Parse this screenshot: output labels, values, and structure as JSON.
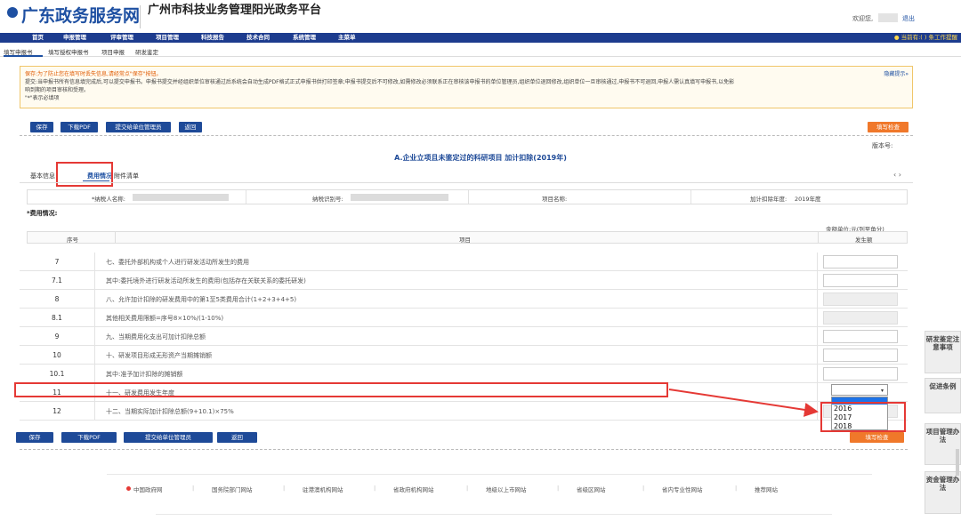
{
  "header": {
    "site_name": "广东政务服务网",
    "platform_title": "广州市科技业务管理阳光政务平台",
    "welcome": "欢迎您,",
    "logout": "退出"
  },
  "nav": {
    "items": [
      "首页",
      "申报管理",
      "评审管理",
      "项目管理",
      "科技报告",
      "技术合同",
      "系统管理",
      "主菜单"
    ],
    "current": "● 当前有:(  ) 条工作提醒"
  },
  "sub_nav": {
    "items": [
      "填写申报书",
      "填写授权申报书",
      "项目申报",
      "研发鉴定"
    ]
  },
  "notice": {
    "line1": "保存:为了防止您在填写时丢失信息,请经常点\"保存\"按钮。",
    "line2": "提交:当申报书所有信息填完成后,可以提交申报书。申报书提交并经组织单位审核通过后系统会自动生成PDF格式正式申报书供打印签章;申报书提交后不可修改,如需修改必须联系正在审核该申报书的单位管理员,组织单位退回修改,组织单位一旦审核通过,申报书不可退回,申报人需认真填写申报书,以免影",
    "line3": "响到期的项目审核和受理。",
    "line4": "\"*\"表示必填项",
    "hint_link": "隐藏提示»"
  },
  "toolbar": {
    "save": "保存",
    "download_pdf": "下载PDF",
    "submit": "提交给单位管理员",
    "back": "返回",
    "check": "填写检查"
  },
  "form": {
    "version_label": "版本号:",
    "title": "A.企业立项且未鉴定过的科研项目 加计扣除(2019年)",
    "tabs": [
      "基本信息",
      "费用情况",
      "附件清单"
    ],
    "tab_arrows": "‹ ›",
    "info": {
      "taxpayer_name_label": "*纳税人名称:",
      "taxpayer_id_label": "纳税识别号:",
      "project_name_label": "项目名称:",
      "deduction_year_label": "加计扣除年度:",
      "deduction_year_value": "2019年度"
    },
    "expense_section": "*费用情况:",
    "unit": "金额单位:元(列至角分)",
    "columns": [
      "序号",
      "项目",
      "发生额"
    ]
  },
  "rows": [
    {
      "no": "7",
      "item": "七、委托外部机构或个人进行研发活动所发生的费用",
      "disabled": false
    },
    {
      "no": "7.1",
      "item": "其中:委托境外进行研发活动所发生的费用(包括存在关联关系的委托研发)",
      "disabled": false
    },
    {
      "no": "8",
      "item": "八、允许加计扣除的研发费用中的第1至5类费用合计(1+2+3+4+5)",
      "disabled": true
    },
    {
      "no": "8.1",
      "item": "其他相关费用限额=序号8×10%/(1-10%)",
      "disabled": true
    },
    {
      "no": "9",
      "item": "九、当期费用化支出可加计扣除总额",
      "disabled": false
    },
    {
      "no": "10",
      "item": "十、研发项目形成无形资产当期摊销额",
      "disabled": false
    },
    {
      "no": "10.1",
      "item": "其中:准予加计扣除的摊销额",
      "disabled": false
    },
    {
      "no": "11",
      "item": "十一、研发费用发生年度",
      "disabled": false
    },
    {
      "no": "12",
      "item": "十二、当期实际加计扣除总额(9+10.1)×75%",
      "disabled": true
    }
  ],
  "year_select": {
    "options": [
      "",
      "2016",
      "2017",
      "2018"
    ]
  },
  "side_tabs": [
    "研发鉴定注意事项",
    "促进条例",
    "项目管理办法",
    "资金管理办法"
  ],
  "footer": {
    "links": [
      "中国政府网",
      "国务院部门网站",
      "驻港澳机构网站",
      "省政府机构网站",
      "地级以上市网站",
      "省级区网站",
      "省内专业性网站",
      "推荐网站"
    ]
  },
  "colors": {
    "nav_bg": "#1d3c8e",
    "primary_button": "#1e4a98",
    "check_button": "#f0782a",
    "highlight_red": "#e53935"
  }
}
